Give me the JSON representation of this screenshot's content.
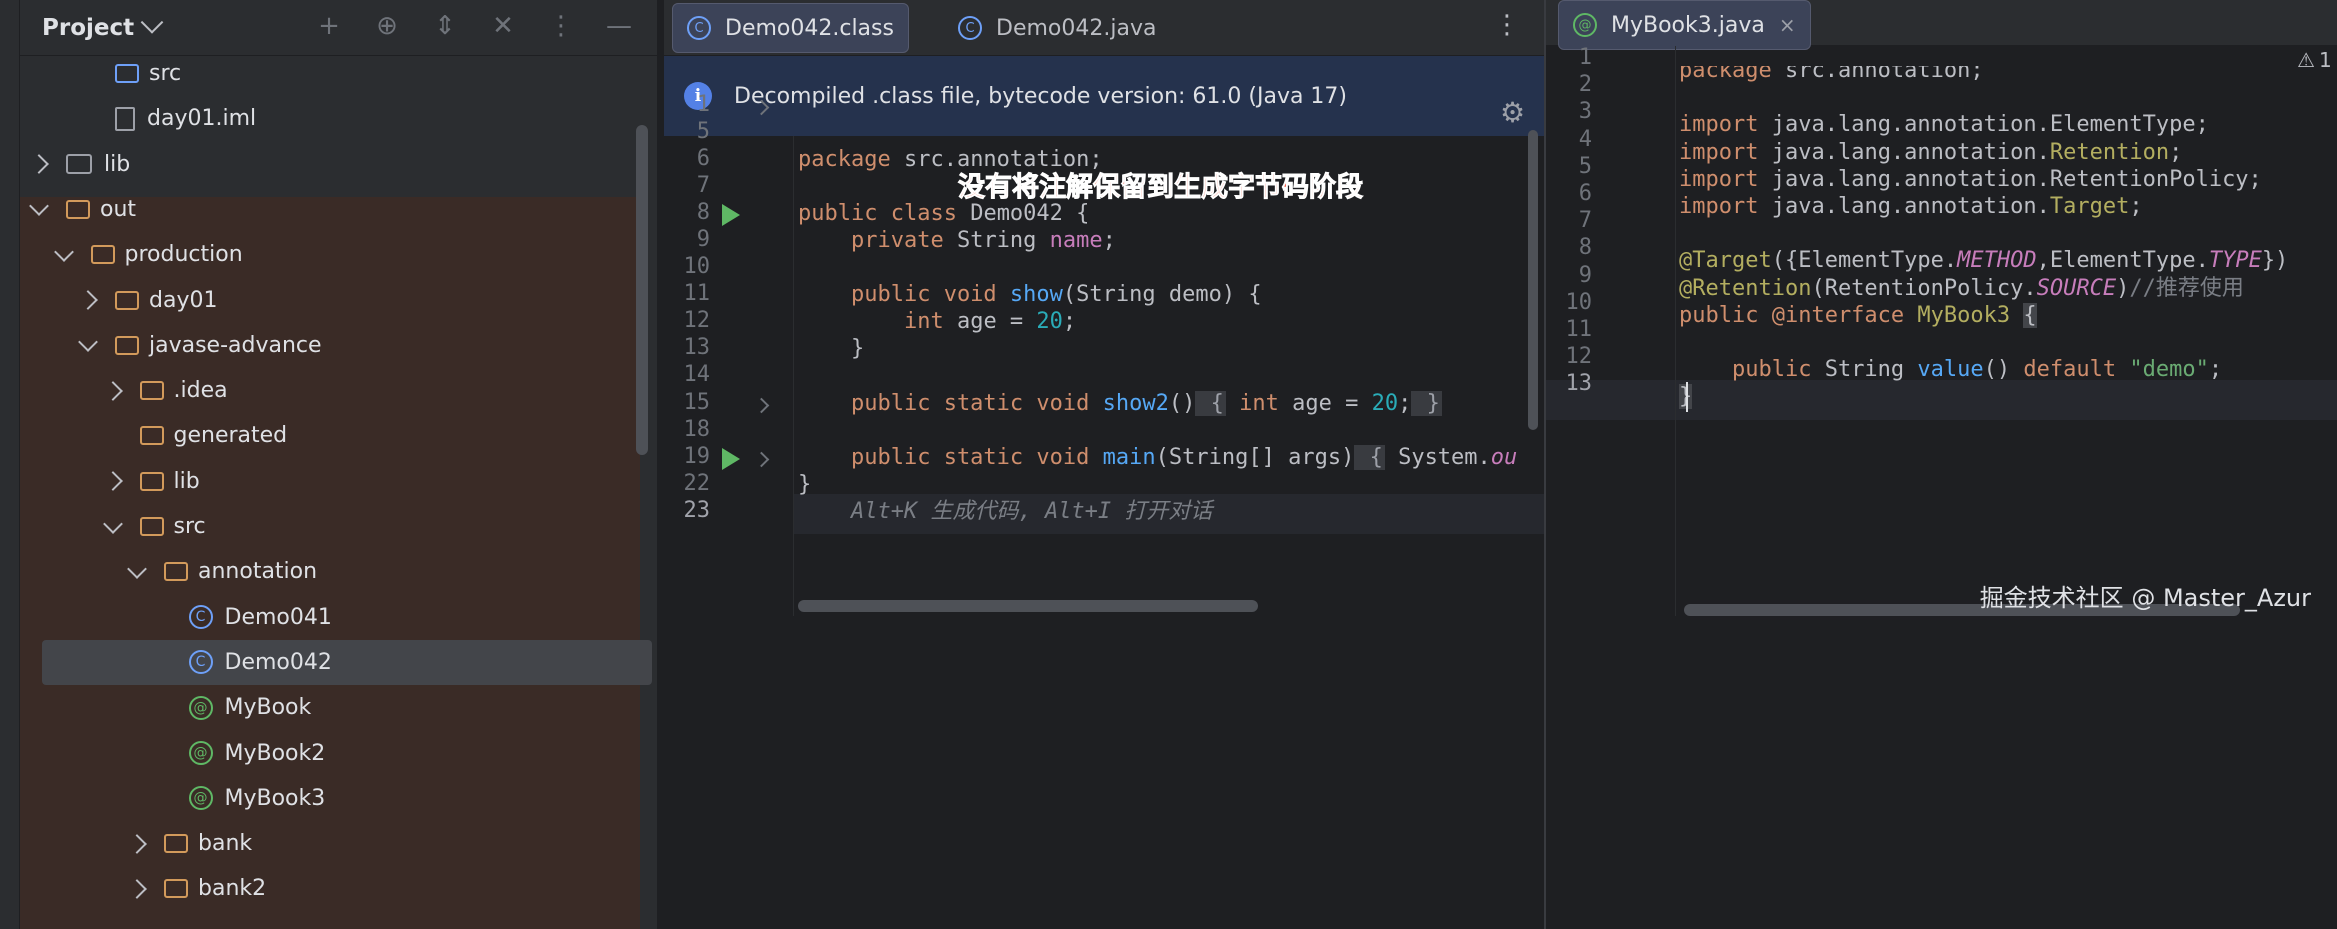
{
  "project": {
    "title": "Project",
    "tree": [
      {
        "label": "src",
        "type": "folder-blue",
        "depth": 3,
        "arrow": "none"
      },
      {
        "label": "day01.iml",
        "type": "file",
        "depth": 3,
        "arrow": "none"
      },
      {
        "label": "lib",
        "type": "lib",
        "depth": 1,
        "arrow": "closed"
      },
      {
        "label": "out",
        "type": "folder",
        "depth": 1,
        "arrow": "open"
      },
      {
        "label": "production",
        "type": "folder",
        "depth": 2,
        "arrow": "open"
      },
      {
        "label": "day01",
        "type": "folder",
        "depth": 3,
        "arrow": "closed"
      },
      {
        "label": "javase-advance",
        "type": "folder",
        "depth": 3,
        "arrow": "open"
      },
      {
        "label": ".idea",
        "type": "folder",
        "depth": 4,
        "arrow": "closed"
      },
      {
        "label": "generated",
        "type": "folder",
        "depth": 4,
        "arrow": "none"
      },
      {
        "label": "lib",
        "type": "folder",
        "depth": 4,
        "arrow": "closed"
      },
      {
        "label": "src",
        "type": "folder",
        "depth": 4,
        "arrow": "open"
      },
      {
        "label": "annotation",
        "type": "folder",
        "depth": 5,
        "arrow": "open"
      },
      {
        "label": "Demo041",
        "type": "class",
        "depth": 6,
        "arrow": "none"
      },
      {
        "label": "Demo042",
        "type": "class",
        "depth": 6,
        "arrow": "none",
        "selected": true
      },
      {
        "label": "MyBook",
        "type": "anno",
        "depth": 6,
        "arrow": "none"
      },
      {
        "label": "MyBook2",
        "type": "anno",
        "depth": 6,
        "arrow": "none"
      },
      {
        "label": "MyBook3",
        "type": "anno",
        "depth": 6,
        "arrow": "none"
      },
      {
        "label": "bank",
        "type": "folder",
        "depth": 5,
        "arrow": "closed"
      },
      {
        "label": "bank2",
        "type": "folder",
        "depth": 5,
        "arrow": "closed"
      }
    ]
  },
  "middle": {
    "tabs": [
      {
        "label": "Demo042.class",
        "icon": "C",
        "active": true
      },
      {
        "label": "Demo042.java",
        "icon": "C",
        "active": false
      }
    ],
    "banner": "Decompiled .class file, bytecode version: 61.0 (Java 17)",
    "annotation_note": "没有将注解保留到生成字节码阶段",
    "line_numbers": [
      "1",
      "5",
      "6",
      "7",
      "8",
      "9",
      "10",
      "11",
      "12",
      "13",
      "14",
      "15",
      "18",
      "19",
      "22",
      "23"
    ],
    "code": {
      "l1": "/.../",
      "l6_kw": "package",
      "l6_rest": " src.annotation;",
      "l8_kw": "public class",
      "l8_rest": " Demo042 {",
      "l9_kw": "    private",
      "l9_type": " String ",
      "l9_field": "name",
      "l9_end": ";",
      "l11_kw": "    public void",
      "l11_fn": " show",
      "l11_rest": "(String demo) {",
      "l12_kw": "        int",
      "l12_rest": " age = ",
      "l12_num": "20",
      "l12_end": ";",
      "l13": "    }",
      "l15_kw": "    public static void",
      "l15_fn": " show2",
      "l15_rest": "()",
      "l15_fold1": " {",
      "l15_kw2": " int",
      "l15_rest2": " age = ",
      "l15_num": "20",
      "l15_end": ";",
      "l15_fold2": " }",
      "l19_kw": "    public static void",
      "l19_fn": " main",
      "l19_rest": "(String[] args)",
      "l19_fold": " {",
      "l19_tail": " System.",
      "l19_out": "ou",
      "l22": "}",
      "l23_hint": "    Alt+K 生成代码, Alt+I 打开对话"
    }
  },
  "right": {
    "tab": {
      "label": "MyBook3.java",
      "icon": "@"
    },
    "warning_count": "1",
    "line_numbers": [
      "1",
      "2",
      "3",
      "4",
      "5",
      "6",
      "7",
      "8",
      "9",
      "10",
      "11",
      "12",
      "13"
    ],
    "code": {
      "l1_kw": "package",
      "l1_rest": " src.annotation;",
      "l3_kw": "import",
      "l3_rest": " java.lang.annotation.ElementType;",
      "l4_kw": "import",
      "l4_rest": " java.lang.annotation.",
      "l4_ann": "Retention",
      "l4_end": ";",
      "l5_kw": "import",
      "l5_rest": " java.lang.annotation.RetentionPolicy;",
      "l6_kw": "import",
      "l6_rest": " java.lang.annotation.",
      "l6_ann": "Target",
      "l6_end": ";",
      "l8_ann": "@Target",
      "l8_a": "({ElementType.",
      "l8_m": "METHOD",
      "l8_b": ",ElementType.",
      "l8_t": "TYPE",
      "l8_c": "})",
      "l9_ann": "@Retention",
      "l9_a": "(RetentionPolicy.",
      "l9_s": "SOURCE",
      "l9_b": ")",
      "l9_cm": "//推荐使用",
      "l10_kw": "public @interface",
      "l10_name": " MyBook3 ",
      "l10_brace": "{",
      "l12_kw": "    public",
      "l12_type": " String ",
      "l12_fn": "value",
      "l12_rest": "() ",
      "l12_kw2": "default",
      "l12_str": " \"demo\"",
      "l12_end": ";",
      "l13": "}"
    },
    "watermark": "掘金技术社区 @ Master_Azur"
  },
  "colors": {
    "keyword": "#cf8e6d",
    "function": "#56a8f5",
    "number": "#2aacb8",
    "field": "#c77dbb",
    "string": "#6aab73",
    "annotation": "#b3ae60",
    "note_red": "#f0503c"
  }
}
